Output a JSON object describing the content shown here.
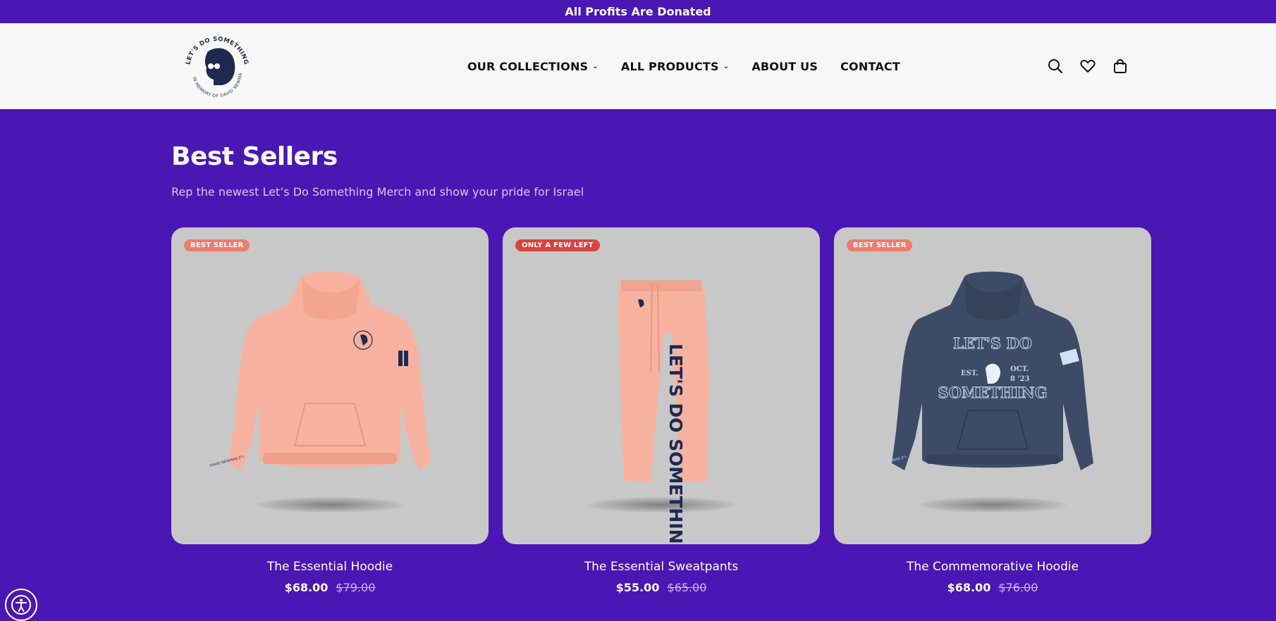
{
  "announcement": "All Profits Are Donated",
  "logo": {
    "top_text": "LET'S DO SOMETHING",
    "bottom_text": "IN MEMORY OF DAVID NEWMAN"
  },
  "nav": {
    "items": [
      {
        "label": "OUR COLLECTIONS",
        "has_dropdown": true
      },
      {
        "label": "ALL PRODUCTS",
        "has_dropdown": true
      },
      {
        "label": "ABOUT US",
        "has_dropdown": false
      },
      {
        "label": "CONTACT",
        "has_dropdown": false
      }
    ]
  },
  "header_icons": [
    "search-icon",
    "heart-icon",
    "bag-icon"
  ],
  "section": {
    "title": "Best Sellers",
    "subtitle": "Rep the newest Let’s Do Something Merch and show your pride for Israel"
  },
  "products": [
    {
      "name": "The Essential Hoodie",
      "price": "$68.00",
      "compare_price": "$79.00",
      "badge": "BEST SELLER",
      "badge_color": "#ec7d6b",
      "color": "#f7b29f"
    },
    {
      "name": "The Essential Sweatpants",
      "price": "$55.00",
      "compare_price": "$65.00",
      "badge": "ONLY A FEW LEFT",
      "badge_color": "#d9443d",
      "color": "#f7b29f",
      "print_text": "LET'S DO SOMETHING."
    },
    {
      "name": "The Commemorative Hoodie",
      "price": "$68.00",
      "compare_price": "$76.00",
      "badge": "BEST SELLER",
      "badge_color": "#ec7d6b",
      "color": "#3d4c66",
      "print_lines": [
        "LET'S DO",
        "EST.",
        "OCT.",
        "8 '23",
        "SOMETHING"
      ]
    }
  ],
  "colors": {
    "background": "#4a17b4",
    "header_bg": "#f8f8f8",
    "card_bg": "#c8c8c8"
  }
}
